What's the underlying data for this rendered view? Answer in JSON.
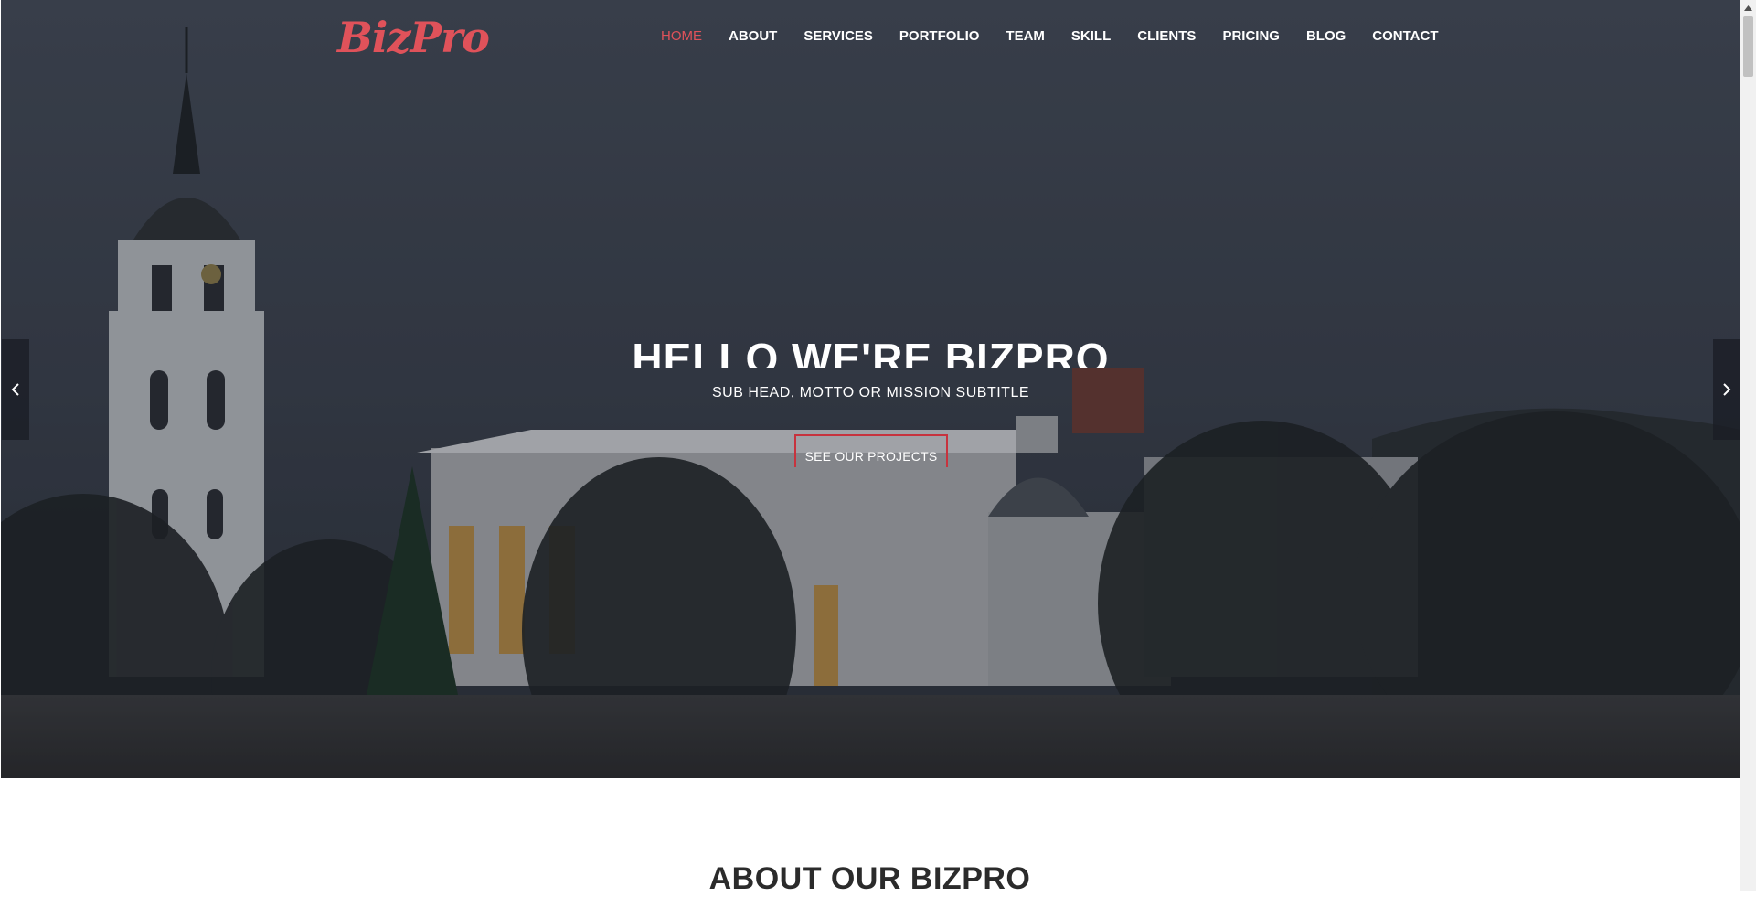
{
  "brand": {
    "logo_text": "BizPro",
    "accent": "#e0525a"
  },
  "nav": {
    "items": [
      {
        "label": "HOME",
        "active": true
      },
      {
        "label": "ABOUT"
      },
      {
        "label": "SERVICES"
      },
      {
        "label": "PORTFOLIO"
      },
      {
        "label": "TEAM"
      },
      {
        "label": "SKILL"
      },
      {
        "label": "CLIENTS"
      },
      {
        "label": "PRICING"
      },
      {
        "label": "BLOG"
      },
      {
        "label": "CONTACT"
      }
    ]
  },
  "hero": {
    "title": "HELLO WE'RE BIZPRO",
    "subtitle": "SUB HEAD, MOTTO OR MISSION SUBTITLE",
    "cta_label": "SEE OUR PROJECTS",
    "prev_icon": "chevron-left-icon",
    "next_icon": "chevron-right-icon"
  },
  "about": {
    "title": "ABOUT OUR BIZPRO"
  }
}
